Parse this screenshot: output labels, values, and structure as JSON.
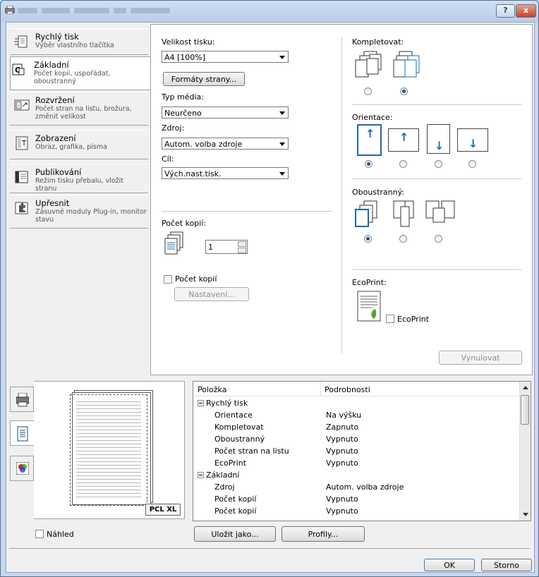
{
  "titlebar": {
    "help_label": "?",
    "close_label": "x"
  },
  "nav": [
    {
      "title": "Rychlý tisk",
      "subtitle": "Výběr vlastního tlačítka"
    },
    {
      "title": "Základní",
      "subtitle": "Počet kopií, uspořádat, oboustranný"
    },
    {
      "title": "Rozvržení",
      "subtitle": "Počet stran na listu, brožura, změnit velikost"
    },
    {
      "title": "Zobrazení",
      "subtitle": "Obraz, grafika, písma"
    },
    {
      "title": "Publikování",
      "subtitle": "Režim tisku přebalu, vložit stranu"
    },
    {
      "title": "Upřesnit",
      "subtitle": "Zásuvné moduly Plug-in, monitor stavu"
    }
  ],
  "main": {
    "print_size_label": "Velikost tisku:",
    "print_size_value": "A4  [100%]",
    "page_formats_button": "Formáty strany...",
    "media_type_label": "Typ média:",
    "media_type_value": "Neurčeno",
    "source_label": "Zdroj:",
    "source_value": "Autom. volba zdroje",
    "destination_label": "Cíl:",
    "destination_value": "Vých.nast.tisk.",
    "copies_label": "Počet kopií:",
    "copies_value": "1",
    "copy_count_check_label": "Počet kopií",
    "settings_button": "Nastavení...",
    "collate_label": "Kompletovat:",
    "orientation_label": "Orientace:",
    "duplex_label": "Oboustranný:",
    "ecoprint_label": "EcoPrint:",
    "ecoprint_check_label": "EcoPrint",
    "reset_button": "Vynulovat"
  },
  "preview": {
    "badge": "PCL XL"
  },
  "summary": {
    "header_item": "Položka",
    "header_details": "Podrobnosti",
    "rows": [
      {
        "type": "group",
        "item": "Rychlý tisk",
        "detail": ""
      },
      {
        "type": "row",
        "item": "Orientace",
        "detail": "Na výšku"
      },
      {
        "type": "row",
        "item": "Kompletovat",
        "detail": "Zapnuto"
      },
      {
        "type": "row",
        "item": "Oboustranný",
        "detail": "Vypnuto"
      },
      {
        "type": "row",
        "item": "Počet stran na listu",
        "detail": "Vypnuto"
      },
      {
        "type": "row",
        "item": "EcoPrint",
        "detail": "Vypnuto"
      },
      {
        "type": "group",
        "item": "Základní",
        "detail": ""
      },
      {
        "type": "row",
        "item": "Zdroj",
        "detail": "Autom. volba zdroje"
      },
      {
        "type": "row",
        "item": "Počet kopií",
        "detail": "Vypnuto"
      },
      {
        "type": "row",
        "item": "Počet kopií",
        "detail": "Vypnuto"
      }
    ]
  },
  "bottom": {
    "preview_check_label": "Náhled",
    "save_as_button": "Uložit jako...",
    "profiles_button": "Profily...",
    "ok_button": "OK",
    "cancel_button": "Storno"
  }
}
